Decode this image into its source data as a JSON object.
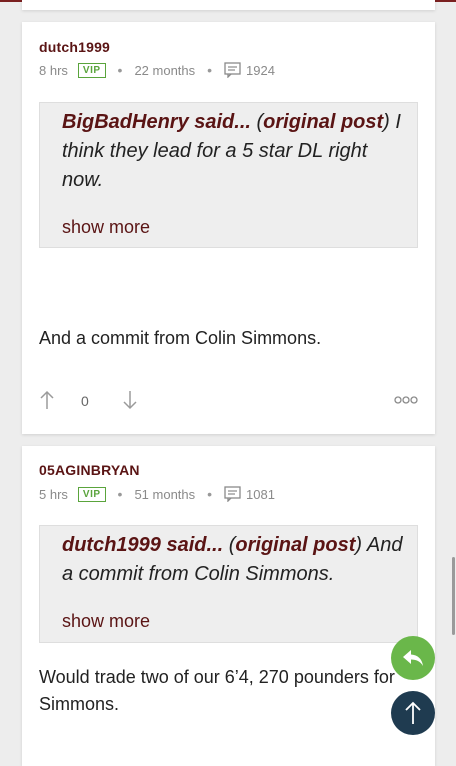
{
  "posts": [
    {
      "username": "dutch1999",
      "time": "8 hrs",
      "badge": "VIP",
      "tenure": "22 months",
      "post_count": "1924",
      "quote": {
        "author_text": "BigBadHenry said...",
        "open_paren": " (",
        "link_text": "original post",
        "close_paren": ")",
        "text": " I think they lead for a 5 star DL right now.",
        "show_more": "show more"
      },
      "body": "And a commit from Colin Simmons.",
      "votes": "0"
    },
    {
      "username": "05AGINBRYAN",
      "time": "5 hrs",
      "badge": "VIP",
      "tenure": "51 months",
      "post_count": "1081",
      "quote": {
        "author_text": "dutch1999 said...",
        "open_paren": " (",
        "link_text": "original post",
        "close_paren": ")",
        "text": " And a commit from Colin Simmons.",
        "show_more": "show more"
      },
      "body": "Would trade two of our 6’4, 270 pounders for Simmons."
    }
  ],
  "separator": "•",
  "colors": {
    "brand": "#5a1414",
    "vip_green": "#5aa43c",
    "reply_fab": "#6ab74a",
    "top_fab": "#1f3b50"
  },
  "icons": {
    "comment": "comment-icon",
    "upvote": "arrow-up-icon",
    "downvote": "arrow-down-icon",
    "more": "more-options-icon",
    "reply": "reply-icon",
    "scroll_top": "arrow-up-icon"
  }
}
